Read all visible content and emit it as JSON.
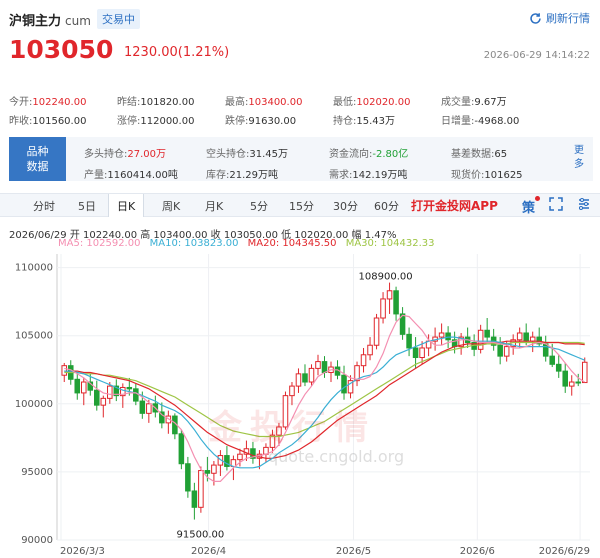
{
  "header": {
    "title": "沪铜主力",
    "code": "cum",
    "status_badge": "交易中",
    "refresh_label": "刷新行情",
    "price": "103050",
    "change": "1230.00(1.21%)",
    "timestamp": "2026-06-29 14:14:22"
  },
  "stats": [
    [
      {
        "label": "今开:",
        "value": "102240.00",
        "color": "red"
      },
      {
        "label": "昨结:",
        "value": "101820.00",
        "color": "normal"
      },
      {
        "label": "最高:",
        "value": "103400.00",
        "color": "red"
      },
      {
        "label": "最低:",
        "value": "102020.00",
        "color": "red"
      },
      {
        "label": "成交量:",
        "value": "9.67万",
        "color": "normal"
      }
    ],
    [
      {
        "label": "昨收:",
        "value": "101560.00",
        "color": "normal"
      },
      {
        "label": "涨停:",
        "value": "112000.00",
        "color": "normal"
      },
      {
        "label": "跌停:",
        "value": "91630.00",
        "color": "normal"
      },
      {
        "label": "持仓:",
        "value": "15.43万",
        "color": "normal"
      },
      {
        "label": "日增量:",
        "value": "-4968.00",
        "color": "normal"
      }
    ]
  ],
  "panel": {
    "badge_line1": "品种",
    "badge_line2": "数据",
    "rows": [
      [
        {
          "label": "多头持仓:",
          "value": "27.00万",
          "color": "red"
        },
        {
          "label": "空头持仓:",
          "value": "31.45万",
          "color": "normal"
        },
        {
          "label": "资金流向:",
          "value": "-2.80亿",
          "color": "green"
        },
        {
          "label": "基差数据:",
          "value": "65",
          "color": "normal"
        }
      ],
      [
        {
          "label": "产量:",
          "value": "1160414.00吨",
          "color": "normal"
        },
        {
          "label": "库存:",
          "value": "21.29万吨",
          "color": "normal"
        },
        {
          "label": "需求:",
          "value": "142.19万吨",
          "color": "normal"
        },
        {
          "label": "现货价:",
          "value": "101625",
          "color": "normal"
        }
      ]
    ],
    "more_label": "更多"
  },
  "tabs": [
    "分时",
    "5日",
    "日K",
    "周K",
    "月K",
    "5分",
    "15分",
    "30分",
    "60分"
  ],
  "active_tab": "日K",
  "app_link": "打开金投网APP",
  "strategy_label": "策",
  "info_line": "2026/06/29  开 102240.00  高 103400.00  收 103050.00  低 102020.00  幅 1.47%",
  "ma_line": {
    "ma5": "MA5: 102592.00",
    "ma10": "MA10: 103823.00",
    "ma20": "MA20: 104345.50",
    "ma30": "MA30: 104432.33"
  },
  "colors": {
    "up": "#e0262b",
    "down": "#20a035",
    "ma5": "#f48fb1",
    "ma10": "#3aafd4",
    "ma20": "#e0262b",
    "ma30": "#9ec545",
    "accent": "#3676c4"
  },
  "watermark": {
    "text": "金投行情",
    "url": "quote.cngold.org"
  },
  "chart_data": {
    "type": "candlestick",
    "x_ticks": [
      "2026/3/3",
      "2026/4",
      "2026/5",
      "2026/6",
      "2026/6/29"
    ],
    "y_ticks": [
      90000,
      95000,
      100000,
      105000,
      110000
    ],
    "ylim": [
      90000,
      111000
    ],
    "annotations": [
      {
        "text": "108900.00",
        "value": 108900
      },
      {
        "text": "91500.00",
        "value": 91500
      }
    ],
    "ohlc": [
      [
        102100,
        103000,
        101600,
        102800
      ],
      [
        102800,
        103200,
        101400,
        101800
      ],
      [
        101800,
        102300,
        100300,
        100800
      ],
      [
        100800,
        101900,
        99900,
        101600
      ],
      [
        101600,
        102200,
        100600,
        101000
      ],
      [
        101000,
        101700,
        99500,
        99900
      ],
      [
        99900,
        100600,
        99000,
        100400
      ],
      [
        100400,
        101600,
        100000,
        101300
      ],
      [
        101300,
        101800,
        100200,
        100600
      ],
      [
        100600,
        101500,
        99700,
        101200
      ],
      [
        101200,
        101900,
        100600,
        101100
      ],
      [
        101100,
        101500,
        99900,
        100200
      ],
      [
        100200,
        100900,
        98900,
        99300
      ],
      [
        99300,
        100300,
        98600,
        100000
      ],
      [
        100000,
        100600,
        99000,
        99400
      ],
      [
        99400,
        100100,
        98200,
        98600
      ],
      [
        98600,
        99500,
        97800,
        99100
      ],
      [
        99100,
        99300,
        97400,
        97800
      ],
      [
        97800,
        98100,
        95200,
        95600
      ],
      [
        95600,
        96100,
        93100,
        93600
      ],
      [
        93600,
        94200,
        91500,
        92400
      ],
      [
        92400,
        95400,
        92000,
        95100
      ],
      [
        95100,
        96100,
        94300,
        94900
      ],
      [
        94900,
        95800,
        94000,
        95500
      ],
      [
        95500,
        96600,
        94700,
        96200
      ],
      [
        96200,
        96900,
        95100,
        95400
      ],
      [
        95400,
        96200,
        94400,
        95900
      ],
      [
        95900,
        96700,
        95400,
        96300
      ],
      [
        96300,
        97300,
        95800,
        96700
      ],
      [
        96700,
        97200,
        95600,
        96000
      ],
      [
        96000,
        96600,
        95200,
        96300
      ],
      [
        96300,
        97100,
        95700,
        96800
      ],
      [
        96800,
        98100,
        96400,
        97700
      ],
      [
        97700,
        98600,
        96900,
        98300
      ],
      [
        98300,
        100900,
        98100,
        100600
      ],
      [
        100600,
        101600,
        99900,
        101300
      ],
      [
        101300,
        102600,
        100800,
        102200
      ],
      [
        102200,
        102900,
        101300,
        101600
      ],
      [
        101600,
        102900,
        101300,
        102600
      ],
      [
        102600,
        103600,
        102100,
        103100
      ],
      [
        103100,
        103500,
        101900,
        102300
      ],
      [
        102300,
        103100,
        101600,
        102700
      ],
      [
        102700,
        103200,
        101800,
        102100
      ],
      [
        102100,
        102800,
        100300,
        100800
      ],
      [
        100800,
        102100,
        100400,
        101700
      ],
      [
        101700,
        103100,
        101300,
        102800
      ],
      [
        102800,
        104100,
        102300,
        103600
      ],
      [
        103600,
        104900,
        103200,
        104300
      ],
      [
        104300,
        106600,
        104000,
        106300
      ],
      [
        106300,
        108200,
        105900,
        107700
      ],
      [
        107700,
        108900,
        106600,
        108300
      ],
      [
        108300,
        108600,
        106100,
        106600
      ],
      [
        106600,
        107100,
        104700,
        105100
      ],
      [
        105100,
        105600,
        103500,
        104100
      ],
      [
        104100,
        104900,
        102600,
        103400
      ],
      [
        103400,
        104600,
        102900,
        104100
      ],
      [
        104100,
        105100,
        103500,
        104600
      ],
      [
        104600,
        105600,
        103900,
        104900
      ],
      [
        104900,
        105900,
        104300,
        105200
      ],
      [
        105200,
        105700,
        104100,
        104700
      ],
      [
        104700,
        105300,
        103700,
        104200
      ],
      [
        104200,
        105200,
        103600,
        104900
      ],
      [
        104900,
        105600,
        104100,
        104500
      ],
      [
        104500,
        105100,
        103500,
        104000
      ],
      [
        104000,
        105800,
        103700,
        105400
      ],
      [
        105400,
        106300,
        104500,
        104900
      ],
      [
        104900,
        105500,
        103900,
        104300
      ],
      [
        104300,
        104900,
        102900,
        103500
      ],
      [
        103500,
        104600,
        103100,
        104200
      ],
      [
        104200,
        105100,
        103600,
        104700
      ],
      [
        104700,
        105600,
        104100,
        105200
      ],
      [
        105200,
        105900,
        104300,
        104600
      ],
      [
        104600,
        105300,
        103800,
        104900
      ],
      [
        104900,
        105600,
        104200,
        104400
      ],
      [
        104400,
        105000,
        103100,
        103500
      ],
      [
        103500,
        104400,
        102700,
        102900
      ],
      [
        102900,
        103600,
        101900,
        102400
      ],
      [
        102400,
        103000,
        100800,
        101300
      ],
      [
        101300,
        102100,
        100600,
        101600
      ],
      [
        101600,
        102200,
        101300,
        101560
      ],
      [
        101560,
        103400,
        102020,
        103050
      ]
    ],
    "ma5": [
      102600,
      102500,
      102200,
      101900,
      101500,
      101100,
      100800,
      100700,
      100700,
      100700,
      100800,
      100800,
      100500,
      100100,
      99700,
      99200,
      98900,
      98600,
      98100,
      97200,
      96100,
      95200,
      94600,
      94300,
      94300,
      94800,
      95300,
      95700,
      96000,
      96100,
      96200,
      96300,
      96500,
      97000,
      97900,
      98900,
      99900,
      100700,
      101300,
      102000,
      102300,
      102500,
      102500,
      102200,
      101900,
      101800,
      101800,
      102000,
      102700,
      103700,
      105000,
      106000,
      106500,
      106400,
      105900,
      105400,
      104700,
      104300,
      104300,
      104500,
      104600,
      104700,
      104700,
      104600,
      104500,
      104500,
      104500,
      104400,
      104300,
      104100,
      104100,
      104200,
      104400,
      104500,
      104400,
      104100,
      103600,
      103000,
      102400,
      101900,
      101600
    ],
    "ma10": [
      102400,
      102400,
      102300,
      102200,
      102000,
      101800,
      101600,
      101400,
      101200,
      101000,
      100900,
      100800,
      100600,
      100400,
      100200,
      99900,
      99700,
      99500,
      99200,
      98700,
      98100,
      97400,
      96800,
      96300,
      95900,
      95600,
      95400,
      95300,
      95300,
      95300,
      95400,
      95700,
      96000,
      96400,
      96700,
      97000,
      97400,
      97900,
      98400,
      99000,
      99700,
      100300,
      100800,
      101200,
      101500,
      101800,
      102000,
      102100,
      102300,
      102700,
      103200,
      103600,
      103800,
      104000,
      104200,
      104400,
      104600,
      104700,
      104800,
      104900,
      104900,
      104800,
      104700,
      104600,
      104600,
      104600,
      104600,
      104500,
      104400,
      104300,
      104200,
      104200,
      104200,
      104200,
      104200,
      104100,
      104000,
      103800,
      103600,
      103400,
      103200
    ],
    "ma20": [
      102400,
      102400,
      102400,
      102300,
      102300,
      102200,
      102100,
      102000,
      101900,
      101800,
      101700,
      101500,
      101300,
      101100,
      100800,
      100500,
      100200,
      99900,
      99500,
      99100,
      98700,
      98300,
      97900,
      97600,
      97300,
      97000,
      96800,
      96600,
      96400,
      96200,
      96100,
      96000,
      96000,
      96100,
      96200,
      96400,
      96600,
      96900,
      97200,
      97600,
      98000,
      98400,
      98800,
      99100,
      99400,
      99700,
      100000,
      100300,
      100600,
      101000,
      101400,
      101700,
      102000,
      102300,
      102600,
      102900,
      103200,
      103500,
      103800,
      104000,
      104200,
      104300,
      104400,
      104400,
      104400,
      104500,
      104500,
      104500,
      104600,
      104600,
      104600,
      104600,
      104600,
      104600,
      104500,
      104500,
      104500,
      104400,
      104400,
      104400,
      104345
    ],
    "ma30": [
      102300,
      102300,
      102300,
      102200,
      102200,
      102200,
      102100,
      102100,
      102000,
      101900,
      101800,
      101700,
      101500,
      101300,
      101100,
      100900,
      100700,
      100500,
      100200,
      99900,
      99600,
      99300,
      99000,
      98700,
      98400,
      98200,
      98000,
      97900,
      97800,
      97700,
      97600,
      97600,
      97600,
      97600,
      97700,
      97800,
      97900,
      98100,
      98300,
      98500,
      98700,
      99000,
      99300,
      99600,
      99900,
      100200,
      100500,
      100800,
      101100,
      101400,
      101700,
      102000,
      102300,
      102600,
      102900,
      103100,
      103300,
      103500,
      103700,
      103900,
      104000,
      104100,
      104200,
      104300,
      104300,
      104400,
      104400,
      104400,
      104400,
      104500,
      104500,
      104500,
      104500,
      104500,
      104500,
      104500,
      104500,
      104500,
      104500,
      104500,
      104432
    ]
  }
}
